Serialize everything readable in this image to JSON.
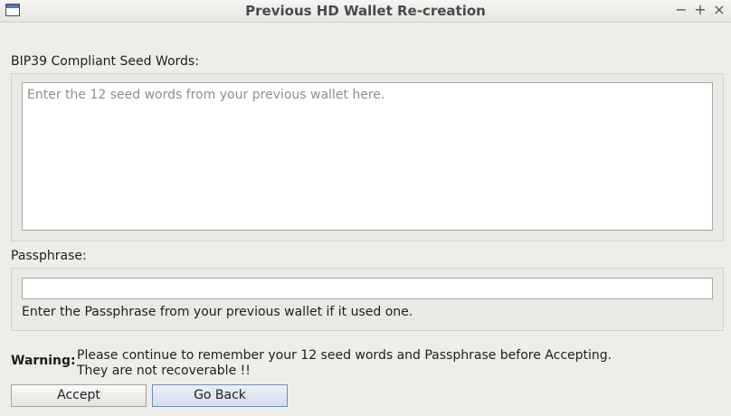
{
  "window": {
    "title": "Previous HD Wallet Re-creation",
    "controls": {
      "minimize": "−",
      "maximize": "+",
      "close": "×"
    }
  },
  "seed": {
    "label": "BIP39 Compliant Seed Words:",
    "placeholder": "Enter the 12 seed words from your previous wallet here.",
    "value": ""
  },
  "passphrase": {
    "label": "Passphrase:",
    "value": "",
    "hint": "Enter the Passphrase from your previous wallet if it used one."
  },
  "warning": {
    "title": "Warning:",
    "line1": "Please continue to remember your 12 seed words and Passphrase before Accepting.",
    "line2": "They are not recoverable !!"
  },
  "buttons": {
    "accept": "Accept",
    "go_back": "Go Back"
  },
  "icons": {
    "app": "window-icon",
    "minimize": "minimize-icon",
    "maximize": "maximize-icon",
    "close": "close-icon"
  },
  "colors": {
    "background": "#efedea",
    "focus_border": "#6f8fb5"
  }
}
